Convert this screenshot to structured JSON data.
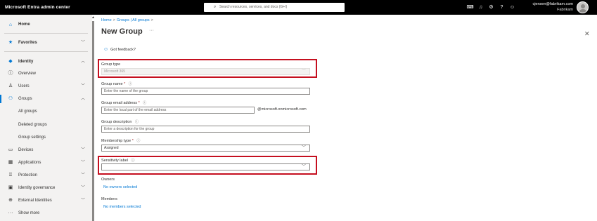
{
  "topbar": {
    "brand": "Microsoft Entra admin center",
    "search_placeholder": "Search resources, services, and docs (G+/)",
    "icons": [
      "cloud-shell-icon",
      "bell-icon",
      "gear-icon",
      "help-icon",
      "feedback-icon"
    ],
    "user_email": "cjensen@fabrikam.com",
    "user_org": "Fabrikam"
  },
  "sidebar": {
    "home": "Home",
    "favorites": "Favorites",
    "identity": "Identity",
    "overview": "Overview",
    "users": "Users",
    "groups": "Groups",
    "all_groups": "All groups",
    "deleted_groups": "Deleted groups",
    "group_settings": "Group settings",
    "devices": "Devices",
    "applications": "Applications",
    "protection": "Protection",
    "identity_governance": "Identity governance",
    "external_identities": "External Identities",
    "show_more": "Show more"
  },
  "main": {
    "breadcrumb": [
      "Home",
      "Groups | All groups"
    ],
    "title": "New Group",
    "feedback": "Got feedback?",
    "group_type": {
      "label": "Group type",
      "value": "Microsoft 365"
    },
    "group_name": {
      "label": "Group name",
      "required": "*",
      "placeholder": "Enter the name of the group"
    },
    "group_email": {
      "label": "Group email address",
      "required": "*",
      "placeholder": "Enter the local part of the email address",
      "suffix": "@microsoft.onmicrosoft.com"
    },
    "group_description": {
      "label": "Group description",
      "placeholder": "Enter a description for the group"
    },
    "membership_type": {
      "label": "Membership type",
      "required": "*",
      "value": "Assigned"
    },
    "sensitivity_label": {
      "label": "Sensitivity label",
      "value": ""
    },
    "owners": {
      "label": "Owners",
      "link": "No owners selected"
    },
    "members": {
      "label": "Members",
      "link": "No members selected"
    }
  },
  "colors": {
    "accent": "#0078d4",
    "highlight_box": "#c50f1f",
    "topbar_bg": "#000000",
    "sidebar_bg": "#f3f2f1"
  }
}
